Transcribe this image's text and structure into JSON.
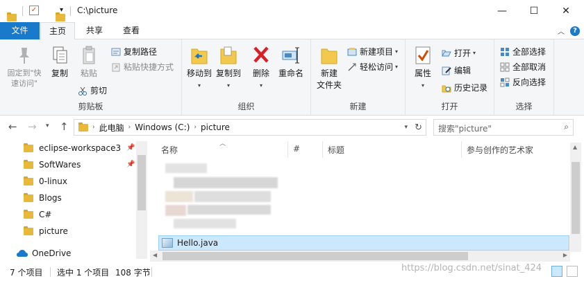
{
  "window": {
    "title": "C:\\picture",
    "controls": {
      "minimize": "—",
      "maximize": "☐",
      "close": "✕"
    }
  },
  "tabs": [
    "文件",
    "主页",
    "共享",
    "查看"
  ],
  "ribbon": {
    "clipboard": {
      "label": "剪贴板",
      "pin": "固定到\"快速访问\"",
      "copy": "复制",
      "paste": "粘贴",
      "copy_path": "复制路径",
      "paste_shortcut": "粘贴快捷方式",
      "cut": "剪切"
    },
    "organize": {
      "label": "组织",
      "move_to": "移动到",
      "copy_to": "复制到",
      "delete": "删除",
      "rename": "重命名"
    },
    "new": {
      "label": "新建",
      "new_folder": "新建\n文件夹",
      "new_item": "新建项目",
      "easy_access": "轻松访问"
    },
    "open": {
      "label": "打开",
      "properties": "属性",
      "open": "打开",
      "edit": "编辑",
      "history": "历史记录"
    },
    "select": {
      "label": "选择",
      "select_all": "全部选择",
      "select_none": "全部取消",
      "invert": "反向选择"
    }
  },
  "address": {
    "crumbs": [
      "此电脑",
      "Windows (C:)",
      "picture"
    ],
    "search_placeholder": "搜索\"picture\""
  },
  "nav": {
    "items": [
      {
        "label": "eclipse-workspace3",
        "pinned": true
      },
      {
        "label": "SoftWares",
        "pinned": true
      },
      {
        "label": "0-linux",
        "pinned": false
      },
      {
        "label": "Blogs",
        "pinned": false
      },
      {
        "label": "C#",
        "pinned": false
      },
      {
        "label": "picture",
        "pinned": false
      }
    ],
    "onedrive": "OneDrive"
  },
  "columns": [
    "名称",
    "#",
    "标题",
    "参与创作的艺术家"
  ],
  "files": [
    {
      "name": "Hello.java",
      "selected": true
    }
  ],
  "status": {
    "count": "7 个项目",
    "selected": "选中 1 个项目",
    "size": "108 字节",
    "watermark": "https://blog.csdn.net/sinat_424"
  }
}
